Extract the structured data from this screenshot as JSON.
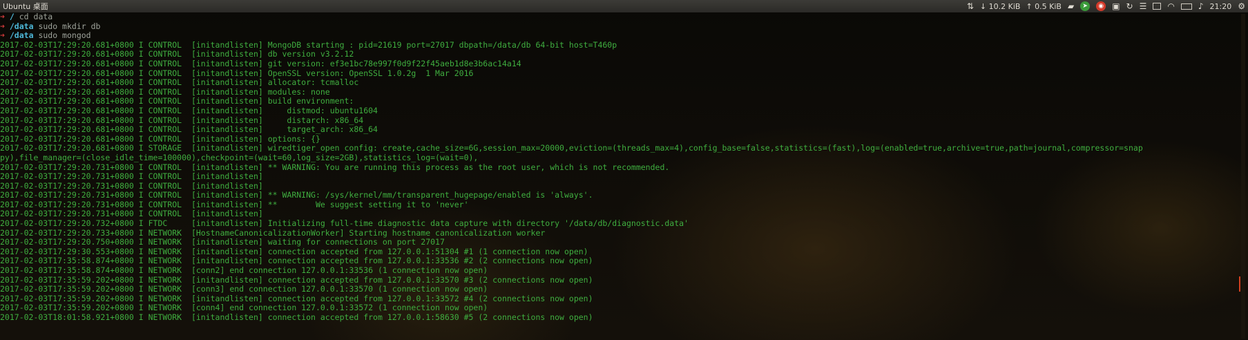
{
  "topbar": {
    "app_title": "Ubuntu 桌面",
    "net_down": "↓ 10.2 KiB",
    "net_up": "↑ 0.5 KiB",
    "clock": "21:20",
    "icons": [
      "network-transfer-icon",
      "chat-icon",
      "telegram-icon",
      "weibo-icon",
      "screenshot-icon",
      "sync-icon",
      "keyboard-input-icon",
      "window-icon",
      "wifi-icon",
      "battery-icon",
      "volume-icon",
      "settings-gear-icon"
    ]
  },
  "terminal": {
    "prompts": [
      {
        "arrow": "➜",
        "path": "/",
        "command": "cd data"
      },
      {
        "arrow": "➜",
        "path": "/data",
        "command": "sudo mkdir db"
      },
      {
        "arrow": "➜",
        "path": "/data",
        "command": "sudo mongod"
      }
    ],
    "log_lines": [
      "2017-02-03T17:29:20.681+0800 I CONTROL  [initandlisten] MongoDB starting : pid=21619 port=27017 dbpath=/data/db 64-bit host=T460p",
      "2017-02-03T17:29:20.681+0800 I CONTROL  [initandlisten] db version v3.2.12",
      "2017-02-03T17:29:20.681+0800 I CONTROL  [initandlisten] git version: ef3e1bc78e997f0d9f22f45aeb1d8e3b6ac14a14",
      "2017-02-03T17:29:20.681+0800 I CONTROL  [initandlisten] OpenSSL version: OpenSSL 1.0.2g  1 Mar 2016",
      "2017-02-03T17:29:20.681+0800 I CONTROL  [initandlisten] allocator: tcmalloc",
      "2017-02-03T17:29:20.681+0800 I CONTROL  [initandlisten] modules: none",
      "2017-02-03T17:29:20.681+0800 I CONTROL  [initandlisten] build environment:",
      "2017-02-03T17:29:20.681+0800 I CONTROL  [initandlisten]     distmod: ubuntu1604",
      "2017-02-03T17:29:20.681+0800 I CONTROL  [initandlisten]     distarch: x86_64",
      "2017-02-03T17:29:20.681+0800 I CONTROL  [initandlisten]     target_arch: x86_64",
      "2017-02-03T17:29:20.681+0800 I CONTROL  [initandlisten] options: {}",
      "2017-02-03T17:29:20.681+0800 I STORAGE  [initandlisten] wiredtiger_open config: create,cache_size=6G,session_max=20000,eviction=(threads_max=4),config_base=false,statistics=(fast),log=(enabled=true,archive=true,path=journal,compressor=snap",
      "py),file_manager=(close_idle_time=100000),checkpoint=(wait=60,log_size=2GB),statistics_log=(wait=0),",
      "2017-02-03T17:29:20.731+0800 I CONTROL  [initandlisten] ** WARNING: You are running this process as the root user, which is not recommended.",
      "2017-02-03T17:29:20.731+0800 I CONTROL  [initandlisten]",
      "2017-02-03T17:29:20.731+0800 I CONTROL  [initandlisten]",
      "2017-02-03T17:29:20.731+0800 I CONTROL  [initandlisten] ** WARNING: /sys/kernel/mm/transparent_hugepage/enabled is 'always'.",
      "2017-02-03T17:29:20.731+0800 I CONTROL  [initandlisten] **        We suggest setting it to 'never'",
      "2017-02-03T17:29:20.731+0800 I CONTROL  [initandlisten]",
      "2017-02-03T17:29:20.732+0800 I FTDC     [initandlisten] Initializing full-time diagnostic data capture with directory '/data/db/diagnostic.data'",
      "2017-02-03T17:29:20.733+0800 I NETWORK  [HostnameCanonicalizationWorker] Starting hostname canonicalization worker",
      "2017-02-03T17:29:20.750+0800 I NETWORK  [initandlisten] waiting for connections on port 27017",
      "2017-02-03T17:29:30.553+0800 I NETWORK  [initandlisten] connection accepted from 127.0.0.1:51304 #1 (1 connection now open)",
      "2017-02-03T17:35:58.874+0800 I NETWORK  [initandlisten] connection accepted from 127.0.0.1:33536 #2 (2 connections now open)",
      "2017-02-03T17:35:58.874+0800 I NETWORK  [conn2] end connection 127.0.0.1:33536 (1 connection now open)",
      "2017-02-03T17:35:59.202+0800 I NETWORK  [initandlisten] connection accepted from 127.0.0.1:33570 #3 (2 connections now open)",
      "2017-02-03T17:35:59.202+0800 I NETWORK  [conn3] end connection 127.0.0.1:33570 (1 connection now open)",
      "2017-02-03T17:35:59.202+0800 I NETWORK  [initandlisten] connection accepted from 127.0.0.1:33572 #4 (2 connections now open)",
      "2017-02-03T17:35:59.202+0800 I NETWORK  [conn4] end connection 127.0.0.1:33572 (1 connection now open)",
      "2017-02-03T18:01:58.921+0800 I NETWORK  [initandlisten] connection accepted from 127.0.0.1:58630 #5 (2 connections now open)"
    ]
  },
  "colors": {
    "log_text": "#3fae3f",
    "prompt_arrow": "#d03a3a",
    "prompt_path": "#4db8d8",
    "topbar_bg": "#3c3b37"
  }
}
